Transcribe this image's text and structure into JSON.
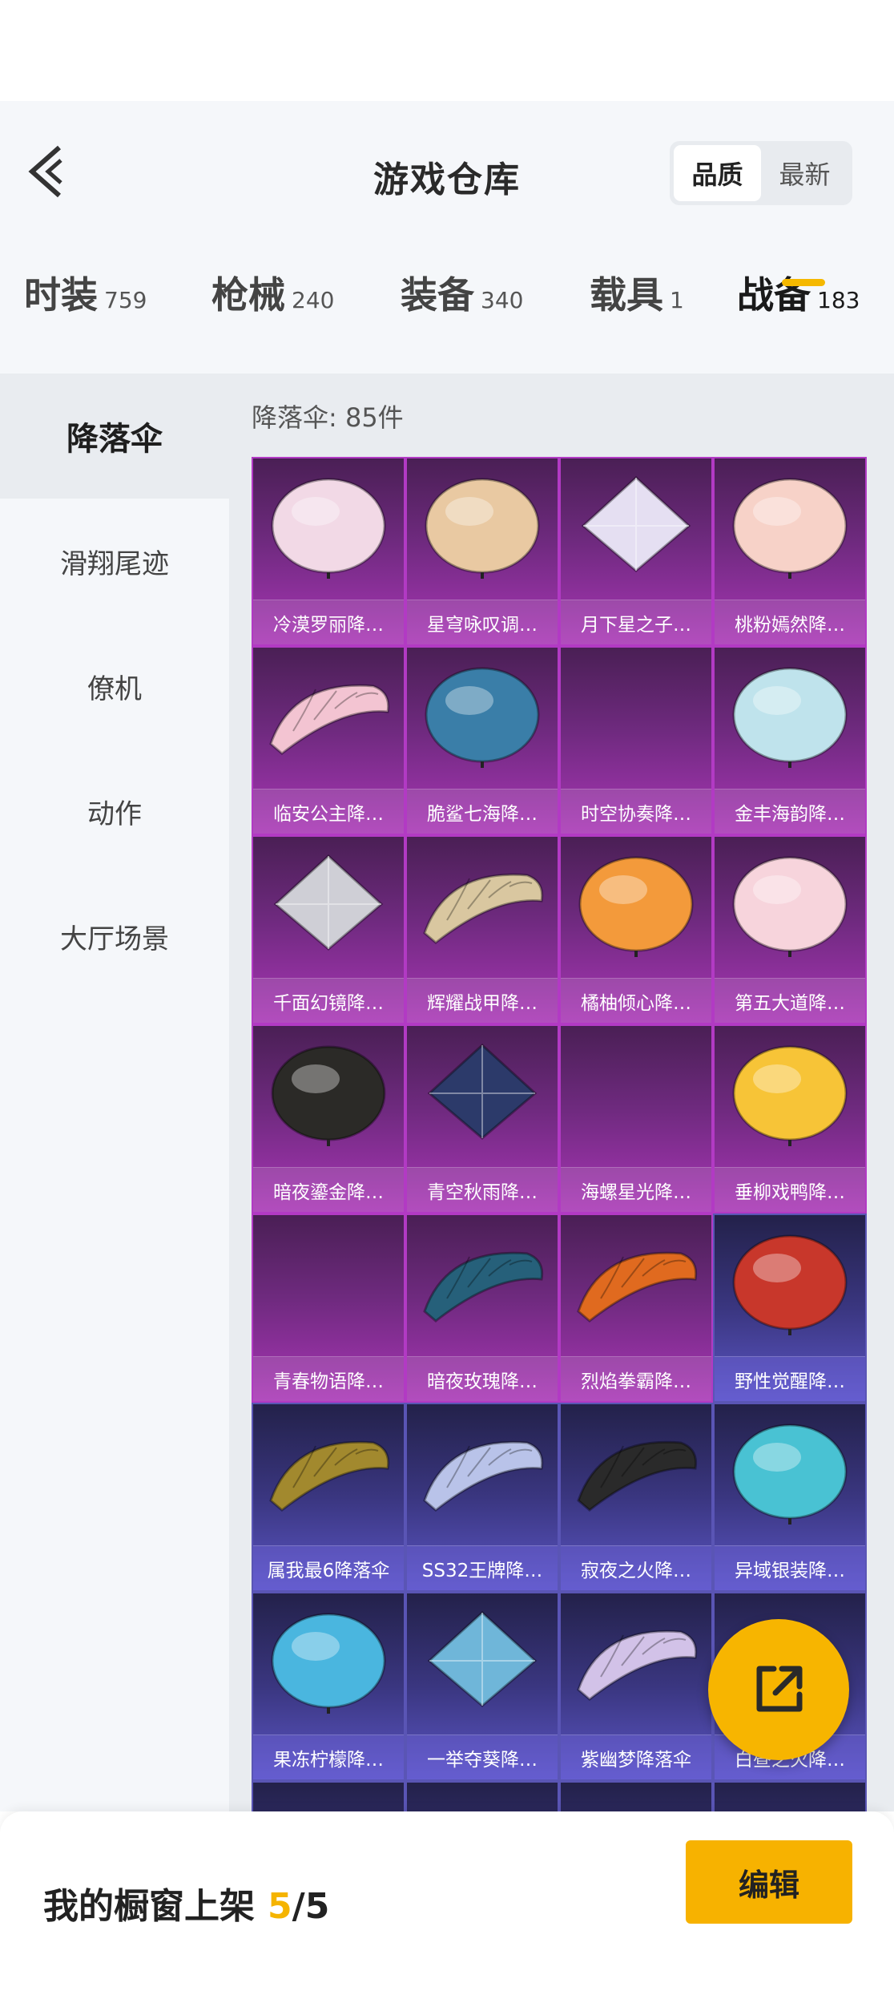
{
  "header": {
    "title": "游戏仓库",
    "sort_options": [
      "品质",
      "最新"
    ]
  },
  "categories": [
    {
      "label": "时装",
      "count": "759"
    },
    {
      "label": "枪械",
      "count": "240"
    },
    {
      "label": "装备",
      "count": "340"
    },
    {
      "label": "载具",
      "count": "1"
    },
    {
      "label": "战备",
      "count": "183"
    }
  ],
  "sidebar": {
    "items": [
      "降落伞",
      "滑翔尾迹",
      "僚机",
      "动作",
      "大厅场景"
    ]
  },
  "content": {
    "title": "降落伞: 85件",
    "items": [
      {
        "name": "冷漠罗丽降…",
        "rarity": "purple",
        "color": "#f2d9e6",
        "shape": "dome"
      },
      {
        "name": "星穹咏叹调…",
        "rarity": "purple",
        "color": "#e9c9a2",
        "shape": "dome"
      },
      {
        "name": "月下星之子…",
        "rarity": "purple",
        "color": "#e5dff2",
        "shape": "diamond"
      },
      {
        "name": "桃粉嫣然降…",
        "rarity": "purple",
        "color": "#f7d2c8",
        "shape": "dome"
      },
      {
        "name": "临安公主降…",
        "rarity": "purple",
        "color": "#f3c4d2",
        "shape": "wing"
      },
      {
        "name": "脆鲨七海降…",
        "rarity": "purple",
        "color": "#3a7ea8",
        "shape": "dome"
      },
      {
        "name": "时空协奏降…",
        "rarity": "purple",
        "color": "",
        "shape": "none"
      },
      {
        "name": "金丰海韵降…",
        "rarity": "purple",
        "color": "#bfe3ec",
        "shape": "dome"
      },
      {
        "name": "千面幻镜降…",
        "rarity": "purple",
        "color": "#cfcfd6",
        "shape": "diamond"
      },
      {
        "name": "辉耀战甲降…",
        "rarity": "purple",
        "color": "#d9c7a0",
        "shape": "wing"
      },
      {
        "name": "橘柚倾心降…",
        "rarity": "purple",
        "color": "#f39a3b",
        "shape": "dome"
      },
      {
        "name": "第五大道降…",
        "rarity": "purple",
        "color": "#f7d4dc",
        "shape": "dome"
      },
      {
        "name": "暗夜鎏金降…",
        "rarity": "purple",
        "color": "#2b2a27",
        "shape": "dome"
      },
      {
        "name": "青空秋雨降…",
        "rarity": "purple",
        "color": "#2c3a6a",
        "shape": "diamond"
      },
      {
        "name": "海螺星光降…",
        "rarity": "purple",
        "color": "",
        "shape": "none"
      },
      {
        "name": "垂柳戏鸭降…",
        "rarity": "purple",
        "color": "#f7c437",
        "shape": "dome"
      },
      {
        "name": "青春物语降…",
        "rarity": "purple",
        "color": "",
        "shape": "none"
      },
      {
        "name": "暗夜玫瑰降…",
        "rarity": "purple",
        "color": "#26607a",
        "shape": "wing"
      },
      {
        "name": "烈焰拳霸降…",
        "rarity": "purple",
        "color": "#e06a1f",
        "shape": "wing"
      },
      {
        "name": "野性觉醒降…",
        "rarity": "blue",
        "color": "#c8372b",
        "shape": "dome"
      },
      {
        "name": "属我最6降落伞",
        "rarity": "blue",
        "color": "#a2892e",
        "shape": "wing"
      },
      {
        "name": "SS32王牌降…",
        "rarity": "blue",
        "color": "#b9c3e9",
        "shape": "wing"
      },
      {
        "name": "寂夜之火降…",
        "rarity": "blue",
        "color": "#2a2a2a",
        "shape": "wing"
      },
      {
        "name": "异域银装降…",
        "rarity": "blue",
        "color": "#49c2d3",
        "shape": "dome"
      },
      {
        "name": "果冻柠檬降…",
        "rarity": "blue",
        "color": "#4ab6df",
        "shape": "dome"
      },
      {
        "name": "一举夺葵降…",
        "rarity": "blue",
        "color": "#6fb6d9",
        "shape": "diamond"
      },
      {
        "name": "紫幽梦降落伞",
        "rarity": "blue",
        "color": "#d2c2e8",
        "shape": "wing"
      },
      {
        "name": "白昼之火降…",
        "rarity": "blue",
        "color": "",
        "shape": "none"
      },
      {
        "name": "",
        "rarity": "blue",
        "color": "",
        "shape": "none"
      },
      {
        "name": "",
        "rarity": "blue",
        "color": "",
        "shape": "none"
      },
      {
        "name": "",
        "rarity": "blue",
        "color": "",
        "shape": "none"
      },
      {
        "name": "",
        "rarity": "blue",
        "color": "",
        "shape": "none"
      }
    ]
  },
  "showcase": {
    "label": "我的橱窗上架",
    "current": "5",
    "total": "/5"
  },
  "edit_label": "编辑",
  "colors": {
    "accent": "#f7b500",
    "purple_rarity": "#b23ac4",
    "blue_rarity": "#5a55b5"
  }
}
